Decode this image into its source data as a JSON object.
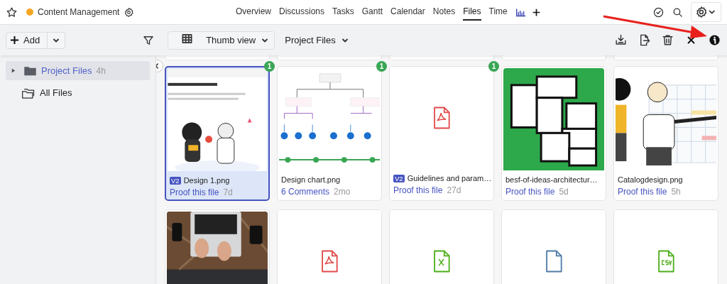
{
  "header": {
    "project_name": "Content Management",
    "color": "#f5a623",
    "tabs": [
      {
        "label": "Overview",
        "selected": false
      },
      {
        "label": "Discussions",
        "selected": false
      },
      {
        "label": "Tasks",
        "selected": false
      },
      {
        "label": "Gantt",
        "selected": false
      },
      {
        "label": "Calendar",
        "selected": false
      },
      {
        "label": "Notes",
        "selected": false
      },
      {
        "label": "Files",
        "selected": true
      },
      {
        "label": "Time",
        "selected": false
      }
    ]
  },
  "toolbar": {
    "add_button": "Add",
    "view_button": "Thumb view",
    "folder_button": "Project Files"
  },
  "sidebar": {
    "items": [
      {
        "kind": "folder",
        "label": "Project Files",
        "meta": "4h",
        "selected": true
      },
      {
        "kind": "all",
        "label": "All Files",
        "selected": false
      }
    ]
  },
  "files": [
    {
      "kind": "birthday",
      "name": "Design 1.png",
      "version": "V2",
      "action": "Proof this file",
      "age": "7d",
      "badge": "1",
      "selected": true
    },
    {
      "kind": "chart",
      "name": "Design chart.png",
      "action": "6 Comments",
      "age": "2mo",
      "badge": "1",
      "selected": false
    },
    {
      "kind": "pdf",
      "name": "Guidelines and param…",
      "version": "V2",
      "action": "Proof this file",
      "age": "27d",
      "badge": "1",
      "selected": false
    },
    {
      "kind": "floorplan",
      "name": "besf-of-ideas-architectur…",
      "action": "Proof this file",
      "age": "5d",
      "selected": false
    },
    {
      "kind": "catalog",
      "name": "Catalogdesign.png",
      "action": "Proof this file",
      "age": "5h",
      "selected": false
    },
    {
      "kind": "laptop",
      "selected": false
    },
    {
      "kind": "pdf",
      "selected": false
    },
    {
      "kind": "xls",
      "selected": false
    },
    {
      "kind": "doc",
      "selected": false
    },
    {
      "kind": "csv",
      "selected": false
    }
  ]
}
